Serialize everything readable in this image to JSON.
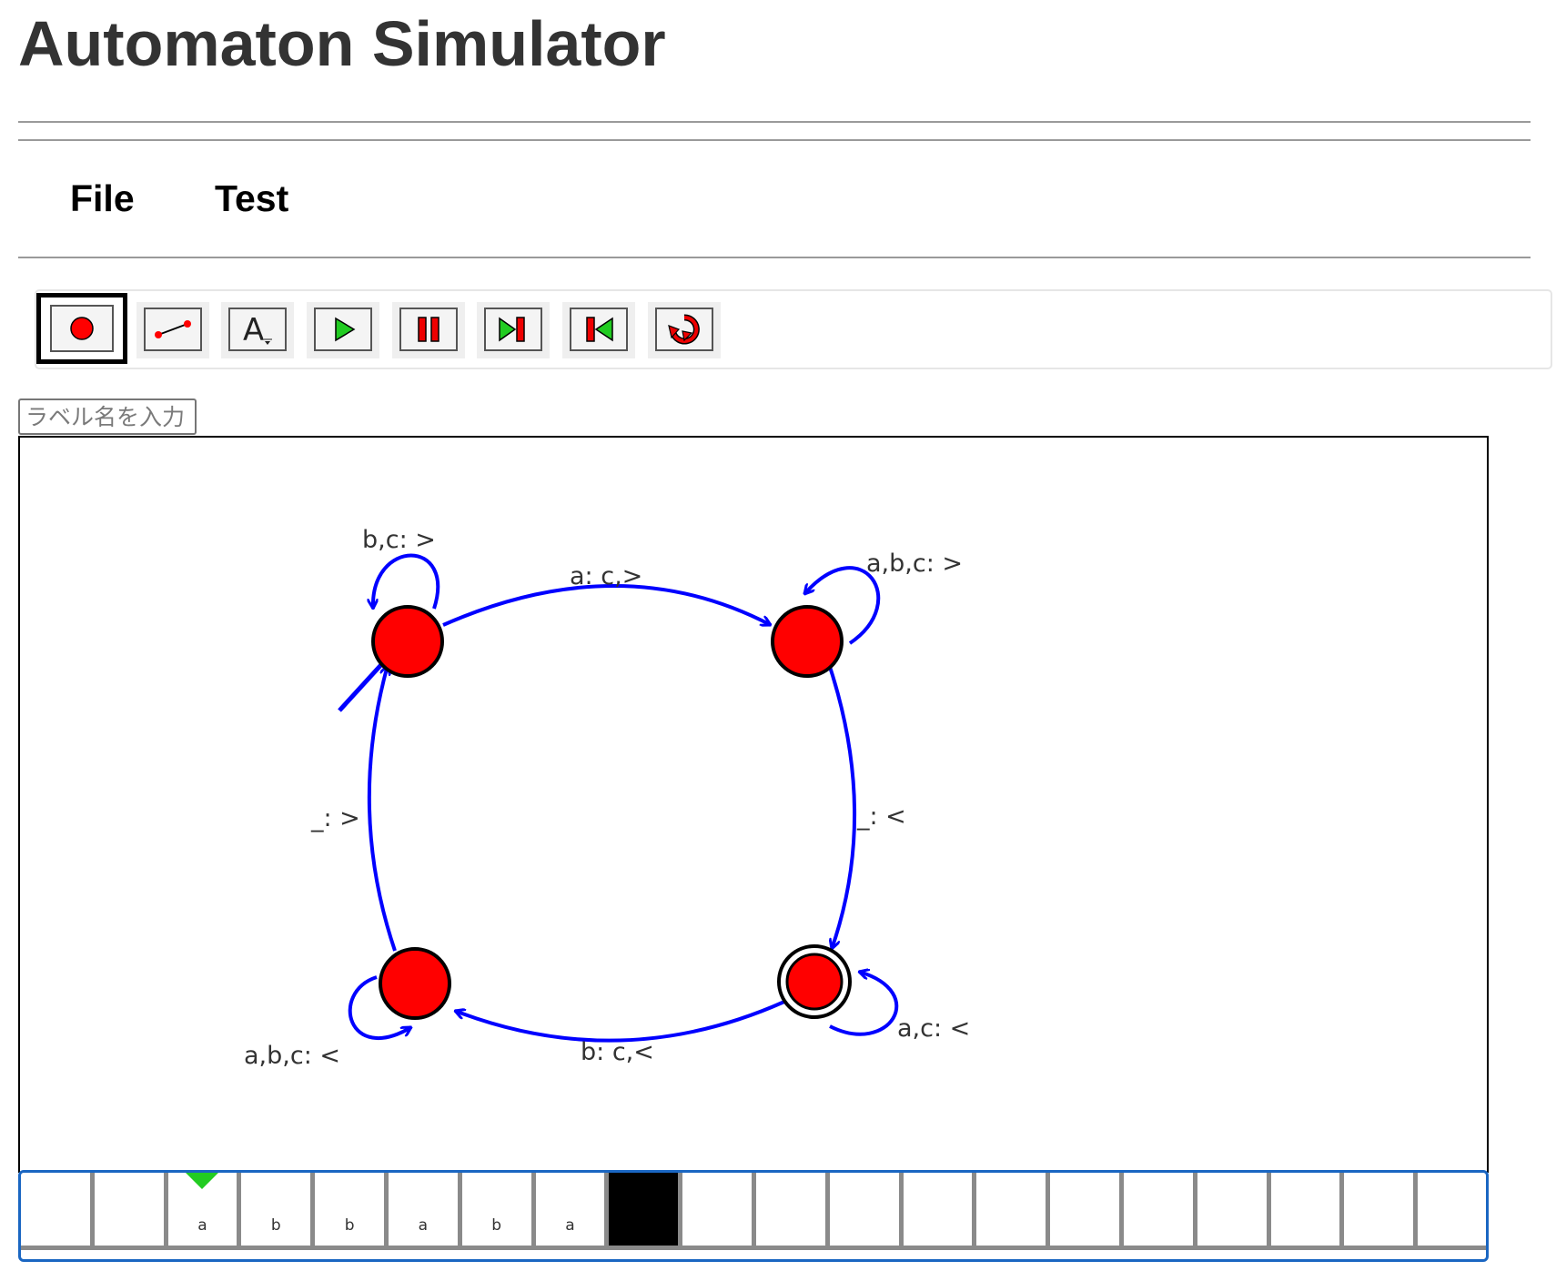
{
  "app": {
    "title": "Automaton Simulator"
  },
  "menu": {
    "items": [
      "File",
      "Test"
    ]
  },
  "toolbar": {
    "buttons": [
      {
        "icon": "state-tool-icon",
        "active": true
      },
      {
        "icon": "transition-tool-icon"
      },
      {
        "icon": "text-tool-icon",
        "glyph": "A"
      },
      {
        "icon": "play-icon"
      },
      {
        "icon": "pause-icon"
      },
      {
        "icon": "step-forward-icon"
      },
      {
        "icon": "step-back-icon"
      },
      {
        "icon": "reset-icon"
      }
    ]
  },
  "label_input": {
    "placeholder": "ラベル名を入力"
  },
  "diagram": {
    "states": [
      {
        "id": "s0",
        "accepting": false,
        "initial": true
      },
      {
        "id": "s1",
        "accepting": false
      },
      {
        "id": "s2",
        "accepting": true
      },
      {
        "id": "s3",
        "accepting": false
      }
    ],
    "transitions": [
      {
        "from": "s0",
        "to": "s0",
        "label": "b,c: >"
      },
      {
        "from": "s0",
        "to": "s1",
        "label": "a: c,>"
      },
      {
        "from": "s1",
        "to": "s1",
        "label": "a,b,c: >"
      },
      {
        "from": "s1",
        "to": "s2",
        "label": "_: <"
      },
      {
        "from": "s2",
        "to": "s2",
        "label": "a,c: <"
      },
      {
        "from": "s2",
        "to": "s3",
        "label": "b: c,<"
      },
      {
        "from": "s3",
        "to": "s3",
        "label": "a,b,c: <"
      },
      {
        "from": "s3",
        "to": "s0",
        "label": "_: >"
      }
    ],
    "colors": {
      "state": "#ff0000",
      "edge": "#0000ff"
    }
  },
  "tape": {
    "cells": [
      "",
      "",
      "a",
      "b",
      "b",
      "a",
      "b",
      "a",
      "",
      "",
      "",
      "",
      "",
      "",
      "",
      "",
      "",
      "",
      "",
      ""
    ],
    "pointer_index": 2,
    "head_index": 8,
    "colors": {
      "pointer": "#22cc22",
      "head": "#000000",
      "border": "#1a66c2"
    }
  }
}
